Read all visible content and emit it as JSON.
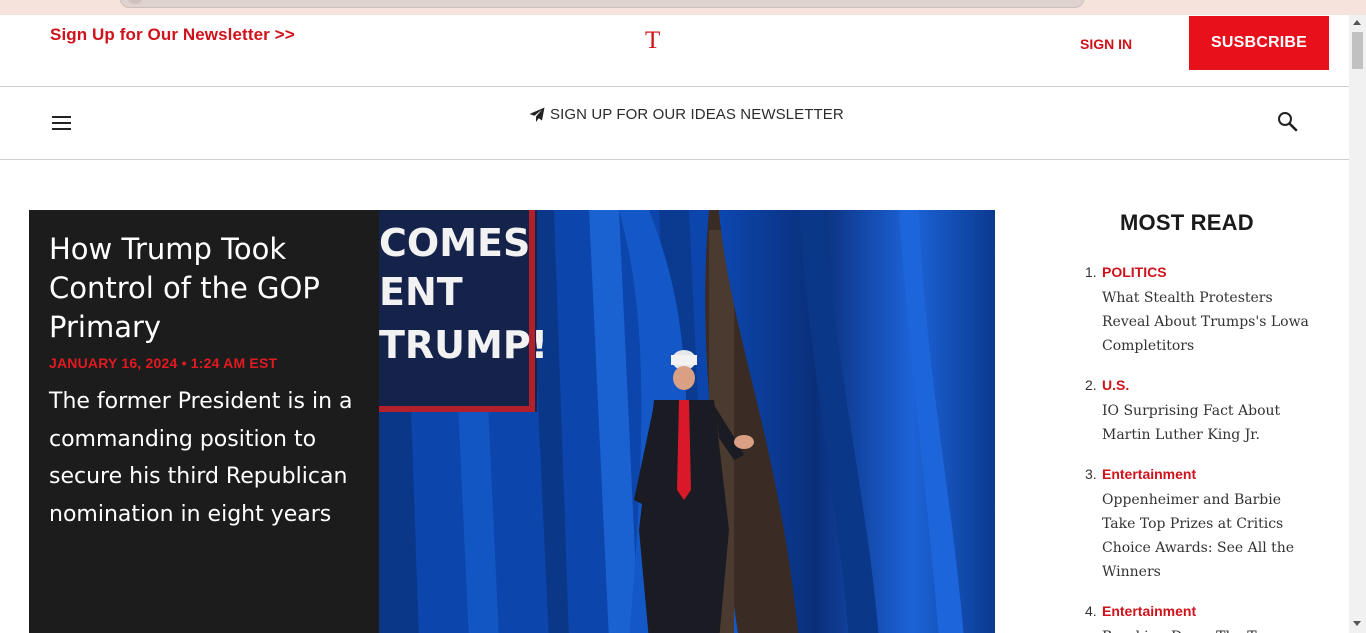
{
  "header": {
    "newsletter_link": "Sign Up for Our Newsletter >>",
    "logo": "T",
    "signin": "SIGN IN",
    "subscribe": "SUSBCRIBE"
  },
  "nav": {
    "ideas_newsletter": "SIGN UP FOR OUR IDEAS NEWSLETTER"
  },
  "hero": {
    "title": "How Trump Took Control of the GOP Primary",
    "date": "JANUARY 16, 2024 • 1:24 AM EST",
    "deck": "The former President is in a commanding position to secure his third Republican nomination in eight years",
    "sign_lines": [
      "COMES",
      "ENT",
      "TRUMP!"
    ]
  },
  "most_read": {
    "title": "MOST READ",
    "items": [
      {
        "num": "1.",
        "category": "POLITICS",
        "headline": "What Stealth Protesters Reveal About Trumps's Lowa Completitors"
      },
      {
        "num": "2.",
        "category": "U.S.",
        "headline": "IO Surprising Fact About Martin Luther King Jr."
      },
      {
        "num": "3.",
        "category": "Entertainment",
        "headline": "Oppenheimer and Barbie Take Top Prizes at Critics Choice Awards: See All the Winners"
      },
      {
        "num": "4.",
        "category": "Entertainment",
        "headline": "Breaking Down The T..."
      }
    ]
  },
  "colors": {
    "brand_red": "#d0121b",
    "subscribe_bg": "#e8101a",
    "hero_panel": "#1c1c1c",
    "curtain_blue": "#0b3f9c"
  },
  "icons": [
    "menu-icon",
    "paper-plane-icon",
    "search-icon"
  ]
}
